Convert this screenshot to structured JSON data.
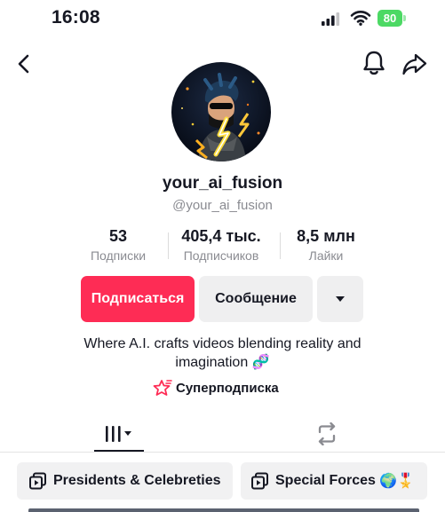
{
  "status_bar": {
    "time": "16:08",
    "battery": "80"
  },
  "profile": {
    "username": "your_ai_fusion",
    "handle": "@your_ai_fusion",
    "stats": [
      {
        "value": "53",
        "label": "Подписки"
      },
      {
        "value": "405,4 тыс.",
        "label": "Подписчиков"
      },
      {
        "value": "8,5 млн",
        "label": "Лайки"
      }
    ],
    "bio_line1": "Where A.I. crafts videos blending reality and",
    "bio_line2": "imagination",
    "bio_emoji": "🧬",
    "super_label": "Суперподписка"
  },
  "actions": {
    "follow": "Подписаться",
    "message": "Сообщение"
  },
  "playlists": [
    {
      "label": "Presidents & Celebreties"
    },
    {
      "label": "Special Forces",
      "emoji": "🌍🎖️"
    }
  ],
  "colors": {
    "accent": "#fe2c55",
    "battery": "#4cd964",
    "secondary_text": "#8a8b91"
  },
  "icons": [
    "back-icon",
    "bell-icon",
    "share-icon",
    "videos-grid-icon",
    "reposts-icon",
    "playlist-icon",
    "dropdown-icon"
  ]
}
